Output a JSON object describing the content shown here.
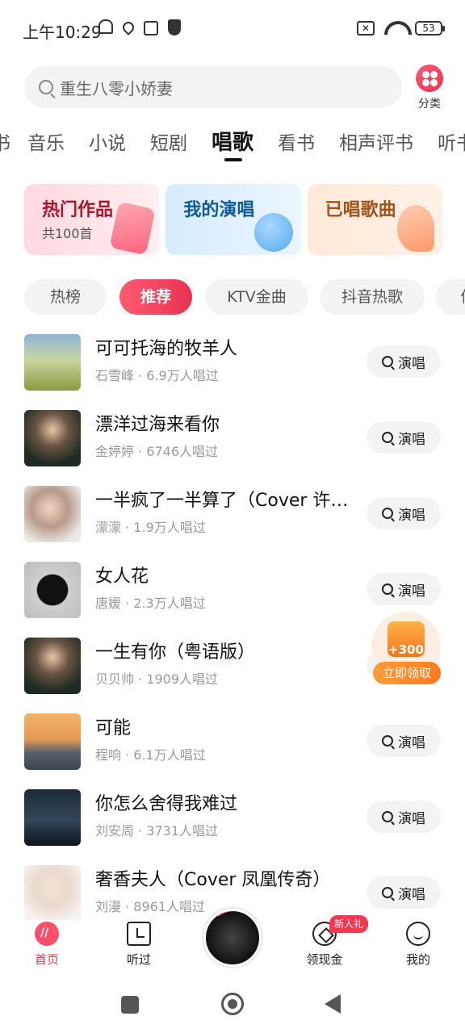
{
  "status_bar": {
    "time": "上午10:29",
    "battery": "53",
    "icons_left": [
      "mute-bell-icon",
      "location-icon",
      "upload-icon",
      "shield-icon"
    ],
    "icons_right": [
      "sim-off-icon",
      "wifi-icon",
      "battery-icon"
    ]
  },
  "search": {
    "placeholder": "重生八零小娇妻",
    "category_label": "分类"
  },
  "tabs": [
    {
      "label": "书",
      "active": false
    },
    {
      "label": "音乐",
      "active": false
    },
    {
      "label": "小说",
      "active": false
    },
    {
      "label": "短剧",
      "active": false
    },
    {
      "label": "唱歌",
      "active": true
    },
    {
      "label": "看书",
      "active": false
    },
    {
      "label": "相声评书",
      "active": false
    },
    {
      "label": "听书",
      "active": false
    }
  ],
  "cards": [
    {
      "title": "热门作品",
      "subtitle": "共100首"
    },
    {
      "title": "我的演唱",
      "subtitle": ""
    },
    {
      "title": "已唱歌曲",
      "subtitle": ""
    }
  ],
  "chips": [
    {
      "label": "热榜",
      "active": false
    },
    {
      "label": "推荐",
      "active": true
    },
    {
      "label": "KTV金曲",
      "active": false
    },
    {
      "label": "抖音热歌",
      "active": false
    },
    {
      "label": "伤",
      "active": false
    }
  ],
  "songs": [
    {
      "title": "可可托海的牧羊人",
      "artist": "石雪峰",
      "count": "6.9万人唱过",
      "cover": "landscape"
    },
    {
      "title": "漂洋过海来看你",
      "artist": "金婷婷",
      "count": "6746人唱过",
      "cover": "portrait-dark"
    },
    {
      "title": "一半疯了一半算了（Cover 许…",
      "artist": "濛濛",
      "count": "1.9万人唱过",
      "cover": "portrait-light"
    },
    {
      "title": "女人花",
      "artist": "唐媛",
      "count": "2.3万人唱过",
      "cover": "disc"
    },
    {
      "title": "一生有你（粤语版）",
      "artist": "贝贝帅",
      "count": "1909人唱过",
      "cover": "portrait-dark"
    },
    {
      "title": "可能",
      "artist": "程响",
      "count": "6.1万人唱过",
      "cover": "sunset"
    },
    {
      "title": "你怎么舍得我难过",
      "artist": "刘安周",
      "count": "3731人唱过",
      "cover": "night"
    },
    {
      "title": "奢香夫人（Cover 凤凰传奇）",
      "artist": "刘漫",
      "count": "8961人唱过",
      "cover": "portrait-white"
    }
  ],
  "sing_label": "演唱",
  "reward": {
    "amount": "+300",
    "button": "立即领取"
  },
  "bottom_nav": [
    {
      "label": "首页",
      "icon": "home-icon",
      "active": true
    },
    {
      "label": "听过",
      "icon": "history-icon",
      "active": false
    },
    {
      "label": "领现金",
      "icon": "cash-icon",
      "active": false
    },
    {
      "label": "我的",
      "icon": "profile-icon",
      "active": false
    }
  ],
  "nav_badge": "新人礼",
  "colors": {
    "accent": "#e8334f",
    "reward": "#ff7a1e"
  }
}
